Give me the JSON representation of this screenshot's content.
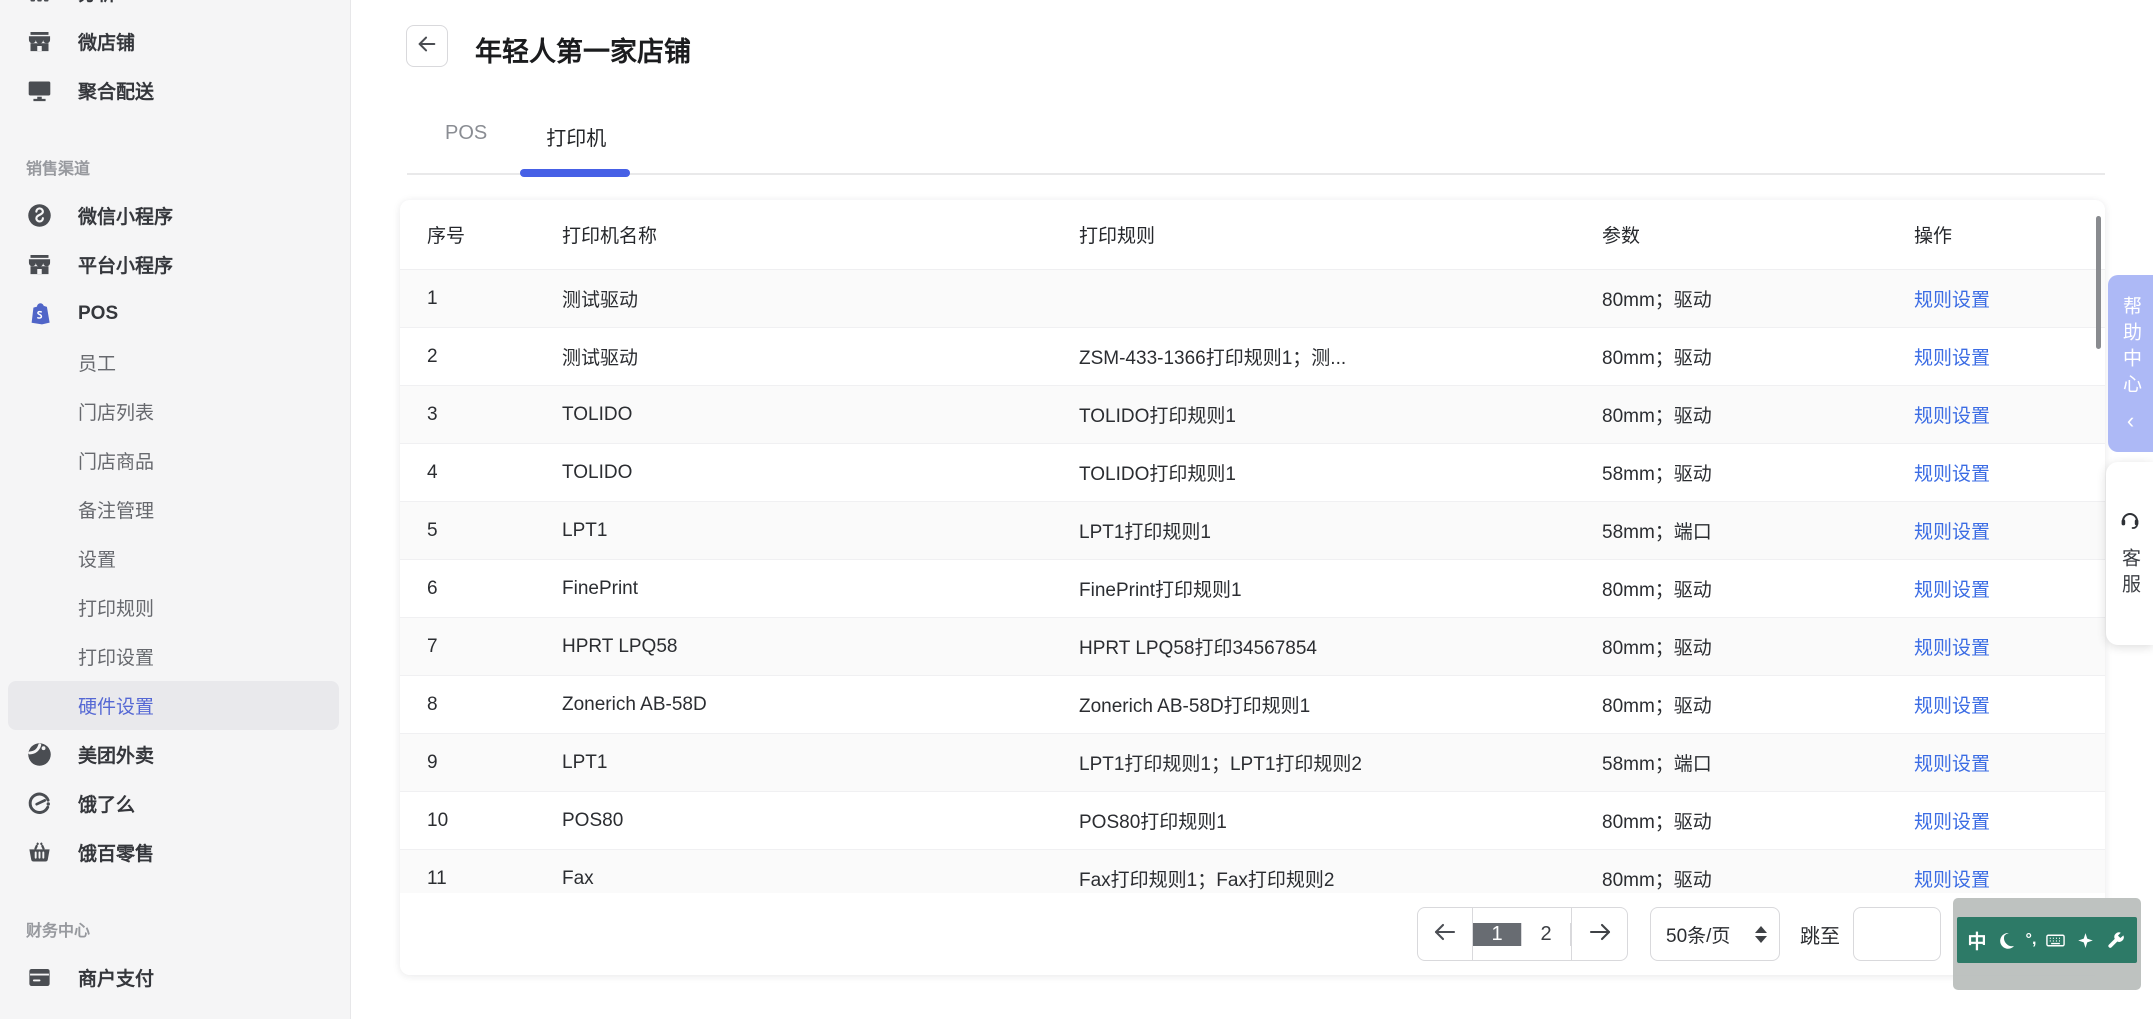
{
  "accent": {
    "link_blue": "#3b6ce4",
    "tab_underline_blue": "#4660e6",
    "sidebar_selected_blue": "#5568d4",
    "help_tab_bg": "#adb9f6",
    "ime_green": "#2d7a67",
    "active_page_bg": "#686c72"
  },
  "sidebar": {
    "sections": [
      {
        "label": "",
        "items": [
          {
            "icon": "analytics-icon",
            "label": "分析",
            "clipped": true
          },
          {
            "icon": "storefront-icon",
            "label": "微店铺"
          },
          {
            "icon": "monitor-icon",
            "label": "聚合配送"
          }
        ]
      },
      {
        "label": "销售渠道",
        "items": [
          {
            "icon": "wechat-miniprogram-icon",
            "label": "微信小程序"
          },
          {
            "icon": "storefront-icon",
            "label": "平台小程序"
          },
          {
            "icon": "pos-bag-icon",
            "label": "POS",
            "children": [
              "员工",
              "门店列表",
              "门店商品",
              "备注管理",
              "设置",
              "打印规则",
              "打印设置",
              "硬件设置"
            ],
            "selected_child": "硬件设置"
          },
          {
            "icon": "meituan-icon",
            "label": "美团外卖"
          },
          {
            "icon": "eleme-icon",
            "label": "饿了么"
          },
          {
            "icon": "basket-icon",
            "label": "饿百零售"
          }
        ]
      },
      {
        "label": "财务中心",
        "items": [
          {
            "icon": "payment-icon",
            "label": "商户支付"
          }
        ]
      }
    ]
  },
  "header": {
    "title": "年轻人第一家店铺"
  },
  "tabs": [
    {
      "label": "POS",
      "active": false
    },
    {
      "label": "打印机",
      "active": true
    }
  ],
  "table": {
    "columns": [
      "序号",
      "打印机名称",
      "打印规则",
      "参数",
      "操作"
    ],
    "action_label": "规则设置",
    "rows": [
      {
        "no": "1",
        "name": "测试驱动",
        "rule": "",
        "params": "80mm；驱动"
      },
      {
        "no": "2",
        "name": "测试驱动",
        "rule": "ZSM-433-1366打印规则1；测...",
        "params": "80mm；驱动"
      },
      {
        "no": "3",
        "name": "TOLIDO",
        "rule": "TOLIDO打印规则1",
        "params": "80mm；驱动"
      },
      {
        "no": "4",
        "name": "TOLIDO",
        "rule": "TOLIDO打印规则1",
        "params": "58mm；驱动"
      },
      {
        "no": "5",
        "name": "LPT1",
        "rule": "LPT1打印规则1",
        "params": "58mm；端口"
      },
      {
        "no": "6",
        "name": "FinePrint",
        "rule": "FinePrint打印规则1",
        "params": "80mm；驱动"
      },
      {
        "no": "7",
        "name": "HPRT LPQ58",
        "rule": "HPRT LPQ58打印34567854",
        "params": "80mm；驱动"
      },
      {
        "no": "8",
        "name": "Zonerich AB-58D",
        "rule": "Zonerich AB-58D打印规则1",
        "params": "80mm；驱动"
      },
      {
        "no": "9",
        "name": "LPT1",
        "rule": "LPT1打印规则1；LPT1打印规则2",
        "params": "58mm；端口"
      },
      {
        "no": "10",
        "name": "POS80",
        "rule": "POS80打印规则1",
        "params": "80mm；驱动"
      },
      {
        "no": "11",
        "name": "Fax",
        "rule": "Fax打印规则1；Fax打印规则2",
        "params": "80mm；驱动"
      }
    ]
  },
  "pagination": {
    "pages": [
      "1",
      "2"
    ],
    "active_page": "1",
    "page_size": "50条/页",
    "jump_label": "跳至",
    "jump_value": ""
  },
  "floaters": {
    "help_label": "帮助中心",
    "help_chevron": "‹",
    "service_label": "客服"
  },
  "ime": {
    "mode": "中",
    "punct": "°,"
  }
}
